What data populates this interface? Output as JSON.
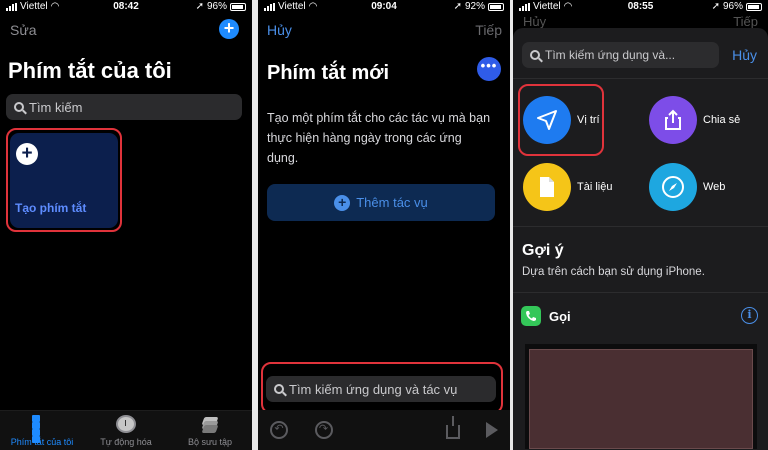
{
  "phone1": {
    "status": {
      "carrier": "Viettel",
      "time": "08:42",
      "battery": "96%"
    },
    "edit_label": "Sửa",
    "title": "Phím tắt của tôi",
    "search_placeholder": "Tìm kiếm",
    "create_label": "Tạo phím tắt",
    "tabs": [
      {
        "label": "Phím tắt của tôi",
        "icon": "grid-icon"
      },
      {
        "label": "Tự động hóa",
        "icon": "clock-icon"
      },
      {
        "label": "Bộ sưu tập",
        "icon": "layers-icon"
      }
    ]
  },
  "phone2": {
    "status": {
      "carrier": "Viettel",
      "time": "09:04",
      "battery": "92%"
    },
    "cancel_label": "Hủy",
    "next_label": "Tiếp",
    "title": "Phím tắt mới",
    "description": "Tạo một phím tắt cho các tác vụ mà bạn thực hiện hàng ngày trong các ứng dụng.",
    "add_action_label": "Thêm tác vụ",
    "search_placeholder": "Tìm kiếm ứng dụng và tác vụ"
  },
  "phone3": {
    "status": {
      "carrier": "Viettel",
      "time": "08:55",
      "battery": "96%"
    },
    "behind_left": "Hủy",
    "behind_right": "Tiếp",
    "search_placeholder": "Tìm kiếm ứng dụng và...",
    "cancel_label": "Hủy",
    "apps": [
      {
        "label": "Vị trí",
        "icon": "location-arrow-icon",
        "color": "#1e7bf0"
      },
      {
        "label": "Chia sẻ",
        "icon": "share-icon",
        "color": "#7d4de8"
      },
      {
        "label": "Tài liệu",
        "icon": "document-icon",
        "color": "#f5c518"
      },
      {
        "label": "Web",
        "icon": "compass-icon",
        "color": "#1ea7e0"
      }
    ],
    "suggestions_title": "Gợi ý",
    "suggestions_subtitle": "Dựa trên cách bạn sử dụng iPhone.",
    "call_label": "Gọi"
  },
  "colors": {
    "accent": "#1e8bff",
    "highlight": "#e0333b",
    "background": "#000000"
  }
}
